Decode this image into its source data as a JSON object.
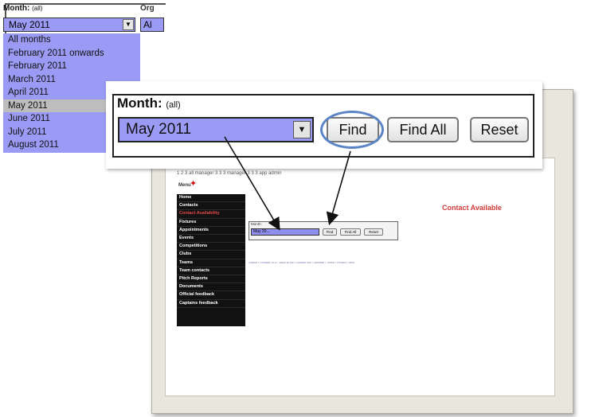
{
  "dropdown_crop": {
    "month_label": "Month:",
    "month_hint": "(all)",
    "org_label": "Org",
    "selected_value": "May 2011",
    "adjacent_peek": "Al",
    "options": [
      "All months",
      "February 2011 onwards",
      "February 2011",
      "March 2011",
      "April 2011",
      "May 2011",
      "June 2011",
      "July 2011",
      "August 2011"
    ],
    "selected_index": 5
  },
  "zoom": {
    "month_label": "Month:",
    "month_hint": "(all)",
    "selected_value": "May 2011",
    "find_label": "Find",
    "find_all_label": "Find All",
    "reset_label": "Reset"
  },
  "site": {
    "breadcrumb": "1 2 3 all manager  3 3 3 manager  3 3 3 app admin",
    "menu_label": "Menu",
    "menu_items": [
      "Home",
      "Contacts",
      "Contact Availability",
      "Fixtures",
      "Appointments",
      "Events",
      "Competitions",
      "Clubs",
      "Teams",
      "Team contacts",
      "Pitch Reports",
      "Documents",
      "Official feedback",
      "Captains feedback"
    ],
    "active_index": 2,
    "contact_title": "Contact Available",
    "mini_form": {
      "label": "Month:",
      "value": "May 20...",
      "find": "Find",
      "find_all": "Find All",
      "reset": "Reset"
    },
    "footer": "Logout | Forward 2011 | Back to top | Contact Info | Sitemap | Terms | Privacy | Help"
  },
  "colors": {
    "select_fill": "#9b9bf6",
    "highlight_ring": "#5a84c6",
    "menu_bg": "#111111",
    "title_red": "#d23a3a"
  }
}
